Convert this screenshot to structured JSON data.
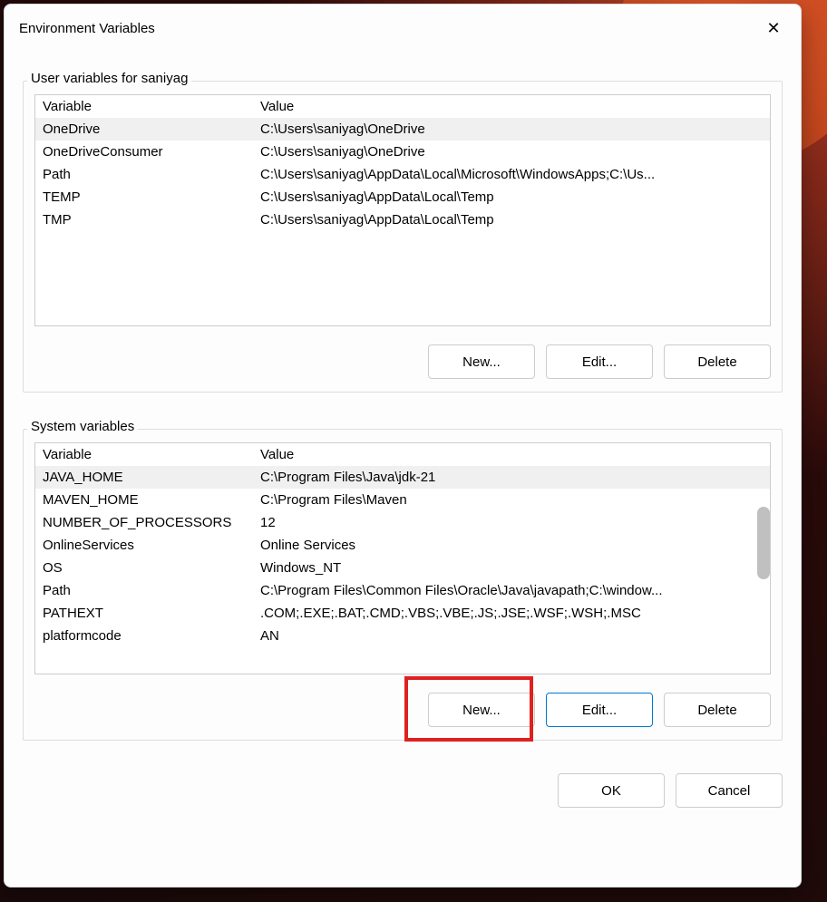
{
  "dialog": {
    "title": "Environment Variables",
    "close_label": "✕"
  },
  "user_section": {
    "label": "User variables for saniyag",
    "col_variable": "Variable",
    "col_value": "Value",
    "rows": [
      {
        "name": "OneDrive",
        "value": "C:\\Users\\saniyag\\OneDrive",
        "selected": true
      },
      {
        "name": "OneDriveConsumer",
        "value": "C:\\Users\\saniyag\\OneDrive",
        "selected": false
      },
      {
        "name": "Path",
        "value": "C:\\Users\\saniyag\\AppData\\Local\\Microsoft\\WindowsApps;C:\\Us...",
        "selected": false
      },
      {
        "name": "TEMP",
        "value": "C:\\Users\\saniyag\\AppData\\Local\\Temp",
        "selected": false
      },
      {
        "name": "TMP",
        "value": "C:\\Users\\saniyag\\AppData\\Local\\Temp",
        "selected": false
      }
    ],
    "buttons": {
      "new": "New...",
      "edit": "Edit...",
      "delete": "Delete"
    }
  },
  "system_section": {
    "label": "System variables",
    "col_variable": "Variable",
    "col_value": "Value",
    "rows": [
      {
        "name": "JAVA_HOME",
        "value": "C:\\Program Files\\Java\\jdk-21",
        "selected": true
      },
      {
        "name": "MAVEN_HOME",
        "value": "C:\\Program Files\\Maven",
        "selected": false
      },
      {
        "name": "NUMBER_OF_PROCESSORS",
        "value": "12",
        "selected": false
      },
      {
        "name": "OnlineServices",
        "value": "Online Services",
        "selected": false
      },
      {
        "name": "OS",
        "value": "Windows_NT",
        "selected": false
      },
      {
        "name": "Path",
        "value": "C:\\Program Files\\Common Files\\Oracle\\Java\\javapath;C:\\window...",
        "selected": false
      },
      {
        "name": "PATHEXT",
        "value": ".COM;.EXE;.BAT;.CMD;.VBS;.VBE;.JS;.JSE;.WSF;.WSH;.MSC",
        "selected": false
      },
      {
        "name": "platformcode",
        "value": "AN",
        "selected": false
      }
    ],
    "buttons": {
      "new": "New...",
      "edit": "Edit...",
      "delete": "Delete"
    }
  },
  "dialog_buttons": {
    "ok": "OK",
    "cancel": "Cancel"
  }
}
